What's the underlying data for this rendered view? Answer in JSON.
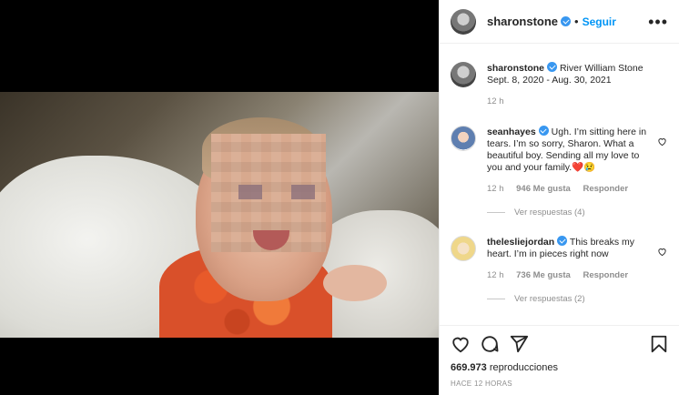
{
  "post": {
    "username": "sharonstone",
    "follow_label": "Seguir",
    "more_label": "•••",
    "caption_user": "sharonstone",
    "caption_text": "River William Stone Sept. 8, 2020 - Aug. 30, 2021",
    "caption_time": "12 h"
  },
  "comments": [
    {
      "username": "seanhayes",
      "text": "Ugh. I’m sitting here in tears. I’m so sorry, Sharon. What a beautiful boy. Sending all my love to you and your family.❤️😢",
      "time": "12 h",
      "likes": "946 Me gusta",
      "reply_label": "Responder",
      "replies": "Ver respuestas (4)"
    },
    {
      "username": "thelesliejordan",
      "text": "This breaks my heart. I’m in pieces right now",
      "time": "12 h",
      "likes": "736 Me gusta",
      "reply_label": "Responder",
      "replies": "Ver respuestas (2)"
    }
  ],
  "footer": {
    "views_count": "669.973",
    "views_label": "reproducciones",
    "timestamp": "HACE 12 HORAS"
  },
  "colors": {
    "verified": "#3897f0",
    "follow": "#0095f6",
    "muted": "#8e8e8e"
  },
  "icons": [
    "heart-icon",
    "comment-icon",
    "share-icon",
    "bookmark-icon",
    "verified-icon",
    "more-options-icon"
  ]
}
